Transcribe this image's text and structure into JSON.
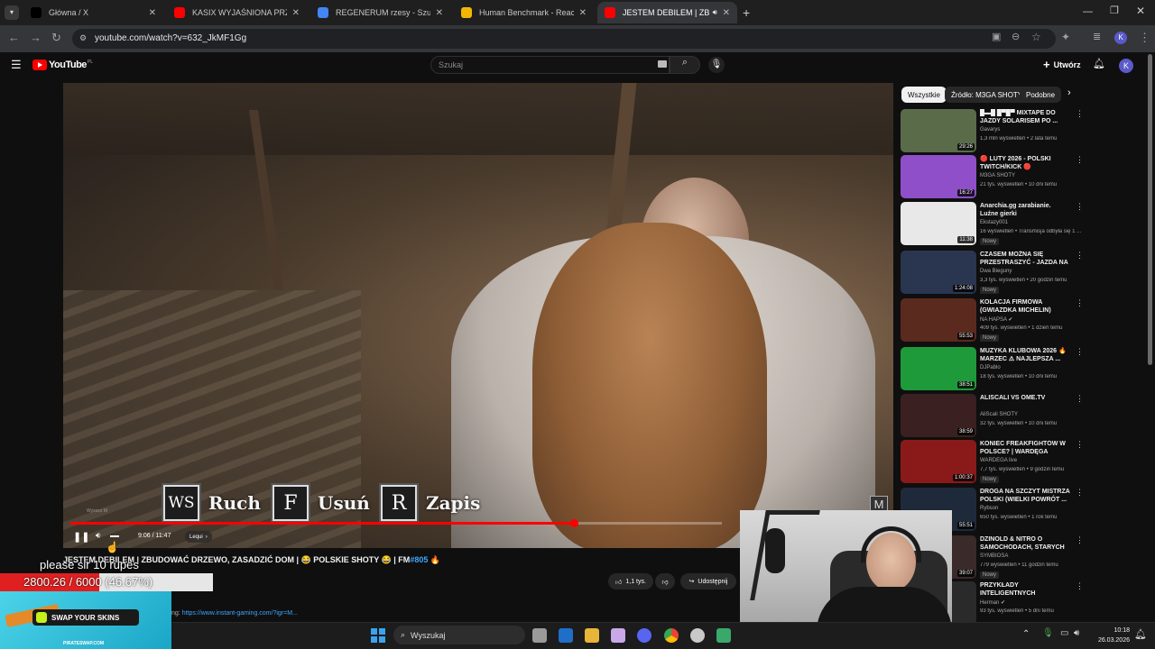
{
  "browser": {
    "tabs": [
      {
        "label": "Główna / X",
        "icon": "x-logo-icon",
        "color": "#000000",
        "active": false
      },
      {
        "label": "KASIX WYJAŚNIONA PRZEZ KA",
        "icon": "youtube-icon",
        "color": "#ff0000",
        "active": false
      },
      {
        "label": "REGENERUM rzesy - Szukaj w G",
        "icon": "google-icon",
        "color": "#4285f4",
        "active": false
      },
      {
        "label": "Human Benchmark - Reaction T",
        "icon": "lightning-icon",
        "color": "#f2b705",
        "active": false
      },
      {
        "label": "JESTEM DEBILEM | ZBUDO",
        "icon": "youtube-icon",
        "color": "#ff0000",
        "active": true
      }
    ],
    "url": "youtube.com/watch?v=632_JkMF1Gg"
  },
  "youtube": {
    "logo": "YouTube",
    "region": "PL",
    "search_placeholder": "Szukaj",
    "create_label": "Utwórz",
    "avatar_letter": "K"
  },
  "player": {
    "hotkeys": [
      {
        "key": "WS",
        "label": "Ruch"
      },
      {
        "key": "F",
        "label": "Usuń"
      },
      {
        "key": "R",
        "label": "Zapis"
      }
    ],
    "game_mark": "M",
    "watermark": "Wyssez M",
    "time": "9:06 / 11:47",
    "chapter": "Lequi",
    "progress": 0.773
  },
  "video": {
    "title": "JESTEM DEBILEM | ZBUDOWAĆ DRZEWO, ZASADZIĆ DOM | 😂 POLSKIE SHOTY 😂 | FM",
    "hashtag": "#805",
    "likes": "1,1 tys.",
    "share_label": "Udostępnij",
    "description_link": "https://www.instant-gaming.com/?igr=M...",
    "description_prefix": "ng:"
  },
  "chips": [
    {
      "label": "Wszystkie",
      "selected": true
    },
    {
      "label": "Źródło: M3GA SHOTY",
      "selected": false
    },
    {
      "label": "Podobne",
      "selected": false
    }
  ],
  "recommendations": [
    {
      "title": "█▬█ █▀█▀ MIXTAPE DO JAZDY SOLARISEM PO ...",
      "channel": "Gavarys",
      "meta": "1,3 mln wyświetleń • 2 lata temu",
      "duration": "29:26",
      "badge": "",
      "thumb": "#5a6b4a"
    },
    {
      "title": "🔴 LUTY 2026 - POLSKI TWITCH/KICK 🔴",
      "channel": "M3GA SHOTY",
      "meta": "21 tys. wyświetleń • 10 dni temu",
      "duration": "16:27",
      "badge": "",
      "thumb": "#8e4fc9"
    },
    {
      "title": "Anarchia.gg zarabianie. Luźne gierki",
      "channel": "Ekstazy001",
      "meta": "16 wyświetleń • Transmisja odbyła się 1 ...",
      "duration": "11:38",
      "badge": "Nowy",
      "thumb": "#e8e8e8"
    },
    {
      "title": "CZASEM MOŻNA SIĘ PRZESTRASZYĆ - JAZDA NA ...",
      "channel": "Dwa Bieguny",
      "meta": "3,3 tys. wyświetleń • 20 godzin temu",
      "duration": "1:24:08",
      "badge": "Nowy",
      "thumb": "#2a3550"
    },
    {
      "title": "KOLACJA FIRMOWA (GWIAZDKA MICHELIN)",
      "channel": "NA HAPSA ✔",
      "meta": "409 tys. wyświetleń • 1 dzień temu",
      "duration": "55:53",
      "badge": "Nowy",
      "thumb": "#5b2a1e"
    },
    {
      "title": "MUZYKA KLUBOWA 2026 🔥 MARZEC ⚠ NAJLEPSZA ...",
      "channel": "DJPablo",
      "meta": "18 tys. wyświetleń • 10 dni temu",
      "duration": "38:51",
      "badge": "",
      "thumb": "#1f9a3a"
    },
    {
      "title": "ALISCALI VS OME.TV",
      "channel": "AliScali SHOTY",
      "meta": "32 tys. wyświetleń • 10 dni temu",
      "duration": "38:59",
      "badge": "",
      "thumb": "#3a2020"
    },
    {
      "title": "KONIEC FREAKFIGHTÓW W POLSCE? | WARDĘGA",
      "channel": "WARDEGA live",
      "meta": "7,7 tys. wyświetleń • 9 godzin temu",
      "duration": "1:00:37",
      "badge": "Nowy",
      "thumb": "#8a1a1a"
    },
    {
      "title": "DROGA NA SZCZYT MISTRZA POLSKI (WIELKI POWRÓT ...",
      "channel": "Rybson",
      "meta": "650 tys. wyświetleń • 1 rok temu",
      "duration": "55:51",
      "badge": "",
      "thumb": "#1e2a3a"
    },
    {
      "title": "DZINOLD & NITRO O SAMOCHODACH, STARYCH ...",
      "channel": "SYMBIOSA",
      "meta": "779 wyświetleń • 11 godzin temu",
      "duration": "39:07",
      "badge": "Nowy",
      "thumb": "#3a2a2a"
    },
    {
      "title": "PRZYKŁADY INTELIGENTNYCH WYPOWIEDZI",
      "channel": "Herman ✔",
      "meta": "93 tys. wyświetleń • 5 dni temu",
      "duration": "",
      "badge": "",
      "thumb": "#2a2a2a"
    }
  ],
  "overlays": {
    "donation": "please sir 10 rupes",
    "goal": "2800.26 / 6000 (46.67%)",
    "goal_fraction": 0.4667,
    "ad_label": "SWAP YOUR SKINS",
    "ad_site": "PIRATESWAP.COM"
  },
  "taskbar": {
    "search": "Wyszukaj",
    "time": "10:18",
    "date": "26.03.2026"
  }
}
